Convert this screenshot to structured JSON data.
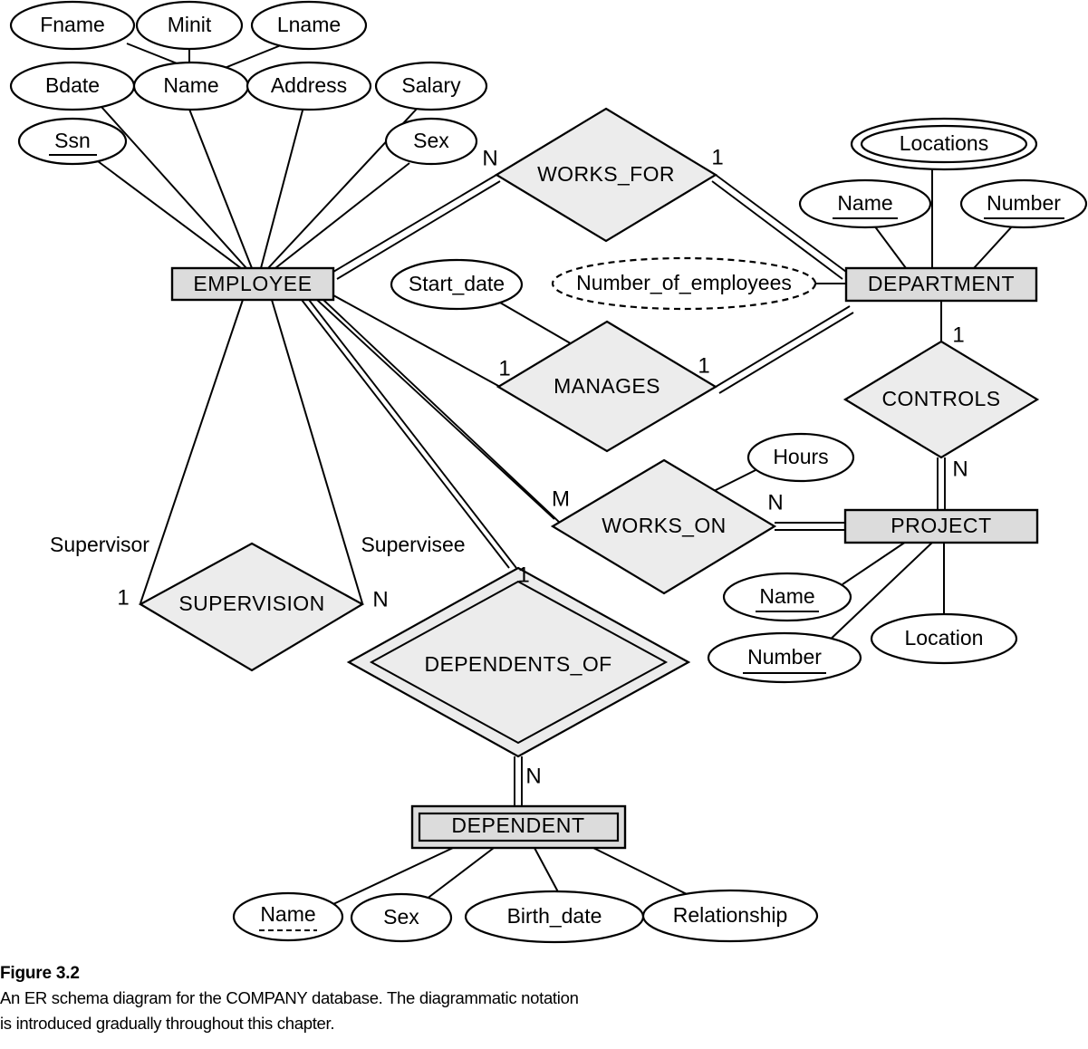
{
  "figure": {
    "title": "Figure 3.2",
    "caption_line1": "An ER schema diagram for the COMPANY database. The diagrammatic notation",
    "caption_line2": "is introduced gradually throughout this chapter."
  },
  "colors": {
    "entity_fill": "#dcdcdc",
    "relationship_fill": "#ececec",
    "attribute_fill": "#ffffff",
    "stroke": "#000000",
    "background": "#ffffff"
  },
  "diagram": {
    "type": "er-schema",
    "entities": [
      {
        "id": "employee",
        "label": "EMPLOYEE",
        "kind": "strong"
      },
      {
        "id": "department",
        "label": "DEPARTMENT",
        "kind": "strong"
      },
      {
        "id": "project",
        "label": "PROJECT",
        "kind": "strong"
      },
      {
        "id": "dependent",
        "label": "DEPENDENT",
        "kind": "weak"
      }
    ],
    "relationships": [
      {
        "id": "works_for",
        "label": "WORKS_FOR",
        "kind": "normal",
        "left_card": "N",
        "right_card": "1"
      },
      {
        "id": "manages",
        "label": "MANAGES",
        "kind": "normal",
        "left_card": "1",
        "right_card": "1"
      },
      {
        "id": "controls",
        "label": "CONTROLS",
        "kind": "normal",
        "left_card": "1",
        "right_card": "N"
      },
      {
        "id": "works_on",
        "label": "WORKS_ON",
        "kind": "normal",
        "left_card": "M",
        "right_card": "N"
      },
      {
        "id": "supervision",
        "label": "SUPERVISION",
        "kind": "normal",
        "left_card": "1",
        "right_card": "N"
      },
      {
        "id": "dependents_of",
        "label": "DEPENDENTS_OF",
        "kind": "identifying",
        "left_card": "1",
        "right_card": "N"
      }
    ],
    "role_labels": [
      {
        "id": "supervisor",
        "label": "Supervisor"
      },
      {
        "id": "supervisee",
        "label": "Supervisee"
      }
    ],
    "cardinality_labels": {
      "works_for_n": "N",
      "works_for_1": "1",
      "manages_left_1": "1",
      "manages_right_1": "1",
      "controls_1": "1",
      "controls_n": "N",
      "works_on_m": "M",
      "works_on_n": "N",
      "supervision_1": "1",
      "supervision_n": "N",
      "dependents_of_1": "1",
      "dependents_of_n": "N"
    },
    "attributes": {
      "employee": [
        {
          "id": "fname",
          "label": "Fname",
          "style": "simple"
        },
        {
          "id": "minit",
          "label": "Minit",
          "style": "simple"
        },
        {
          "id": "lname",
          "label": "Lname",
          "style": "simple"
        },
        {
          "id": "bdate",
          "label": "Bdate",
          "style": "simple"
        },
        {
          "id": "name",
          "label": "Name",
          "style": "composite"
        },
        {
          "id": "address",
          "label": "Address",
          "style": "simple"
        },
        {
          "id": "salary",
          "label": "Salary",
          "style": "simple"
        },
        {
          "id": "ssn",
          "label": "Ssn",
          "style": "key"
        },
        {
          "id": "sex",
          "label": "Sex",
          "style": "simple"
        }
      ],
      "department": [
        {
          "id": "dept_locations",
          "label": "Locations",
          "style": "multivalued"
        },
        {
          "id": "dept_name",
          "label": "Name",
          "style": "key"
        },
        {
          "id": "dept_number",
          "label": "Number",
          "style": "key"
        },
        {
          "id": "num_employees",
          "label": "Number_of_employees",
          "style": "derived"
        }
      ],
      "project": [
        {
          "id": "proj_name",
          "label": "Name",
          "style": "key"
        },
        {
          "id": "proj_number",
          "label": "Number",
          "style": "key"
        },
        {
          "id": "proj_location",
          "label": "Location",
          "style": "simple"
        }
      ],
      "dependent": [
        {
          "id": "dep_name",
          "label": "Name",
          "style": "partial-key"
        },
        {
          "id": "dep_sex",
          "label": "Sex",
          "style": "simple"
        },
        {
          "id": "dep_birth_date",
          "label": "Birth_date",
          "style": "simple"
        },
        {
          "id": "dep_relationship",
          "label": "Relationship",
          "style": "simple"
        }
      ],
      "manages": [
        {
          "id": "start_date",
          "label": "Start_date",
          "style": "simple"
        }
      ],
      "works_on": [
        {
          "id": "hours",
          "label": "Hours",
          "style": "simple"
        }
      ]
    }
  }
}
